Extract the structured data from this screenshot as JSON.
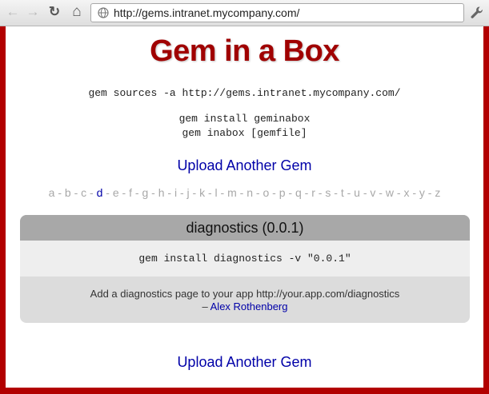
{
  "browser": {
    "url": "http://gems.intranet.mycompany.com/",
    "back_icon": "←",
    "forward_icon": "→",
    "reload_icon": "↻",
    "home_icon": "⌂"
  },
  "page": {
    "title": "Gem in a Box",
    "commands": {
      "sources": "gem sources -a http://gems.intranet.mycompany.com/",
      "install": "gem install geminabox",
      "inabox": "gem inabox [gemfile]"
    },
    "upload_label": "Upload Another Gem",
    "alphabet": [
      "a",
      "b",
      "c",
      "d",
      "e",
      "f",
      "g",
      "h",
      "i",
      "j",
      "k",
      "l",
      "m",
      "n",
      "o",
      "p",
      "q",
      "r",
      "s",
      "t",
      "u",
      "v",
      "w",
      "x",
      "y",
      "z"
    ],
    "active_letter": "d",
    "gem": {
      "name": "diagnostics (0.0.1)",
      "install_cmd": "gem install diagnostics -v \"0.0.1\"",
      "description": "Add a diagnostics page to your app http://your.app.com/diagnostics",
      "author_prefix": "–",
      "author": "Alex Rothenberg"
    },
    "colors": {
      "frame": "#b20000",
      "title": "#a00000",
      "link": "#0000a8"
    }
  }
}
